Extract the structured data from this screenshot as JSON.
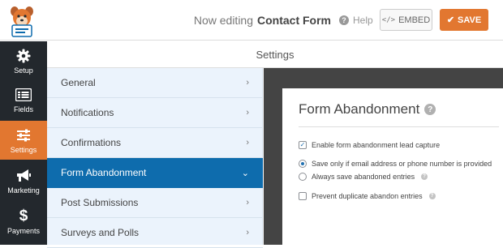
{
  "header": {
    "editing_prefix": "Now editing",
    "form_name": "Contact Form",
    "help_label": "Help",
    "embed_label": "EMBED",
    "save_label": "SAVE"
  },
  "sidebar": {
    "items": [
      {
        "label": "Setup",
        "icon": "gear-icon"
      },
      {
        "label": "Fields",
        "icon": "fields-list-icon"
      },
      {
        "label": "Settings",
        "icon": "sliders-icon",
        "active": true
      },
      {
        "label": "Marketing",
        "icon": "megaphone-icon"
      },
      {
        "label": "Payments",
        "icon": "dollar-icon"
      }
    ]
  },
  "page": {
    "title": "Settings"
  },
  "settings_nav": {
    "items": [
      {
        "label": "General"
      },
      {
        "label": "Notifications"
      },
      {
        "label": "Confirmations"
      },
      {
        "label": "Form Abandonment",
        "active": true
      },
      {
        "label": "Post Submissions"
      },
      {
        "label": "Surveys and Polls"
      }
    ]
  },
  "panel": {
    "title": "Form Abandonment",
    "enable_label": "Enable form abandonment lead capture",
    "enable_checked": true,
    "radio_options": [
      {
        "label": "Save only if email address or phone number is provided",
        "selected": true
      },
      {
        "label": "Always save abandoned entries",
        "selected": false
      }
    ],
    "prevent_label": "Prevent duplicate abandon entries",
    "prevent_checked": false
  },
  "colors": {
    "accent_orange": "#e27730",
    "active_nav_blue": "#0e6cad",
    "sidebar_dark": "#23282d",
    "nav_bg": "#ebf3fc"
  }
}
